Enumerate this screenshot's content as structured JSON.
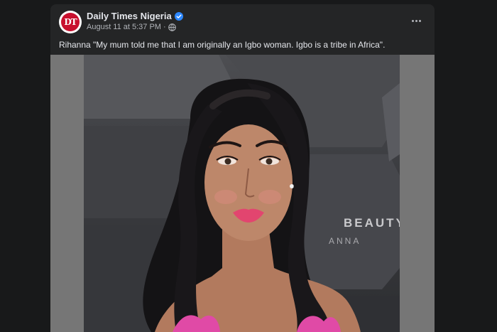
{
  "post": {
    "page_name": "Daily Times Nigeria",
    "avatar_text": "DT",
    "timestamp": "August 11 at 5:37 PM",
    "separator": "·",
    "caption": "Rihanna \"My mum told me that I am originally an Igbo woman. Igbo is a tribe in Africa\".",
    "more_icon": "ellipsis-icon",
    "verified_icon": "verified-badge-icon",
    "audience_icon": "globe-icon"
  },
  "photo": {
    "backdrop_text_line1": "BEAUTY",
    "backdrop_text_line2": "ANNA"
  },
  "colors": {
    "page_bg": "#18191a",
    "card_bg": "#242526",
    "verified_blue": "#2d88ff",
    "brand_red": "#c8102e"
  }
}
